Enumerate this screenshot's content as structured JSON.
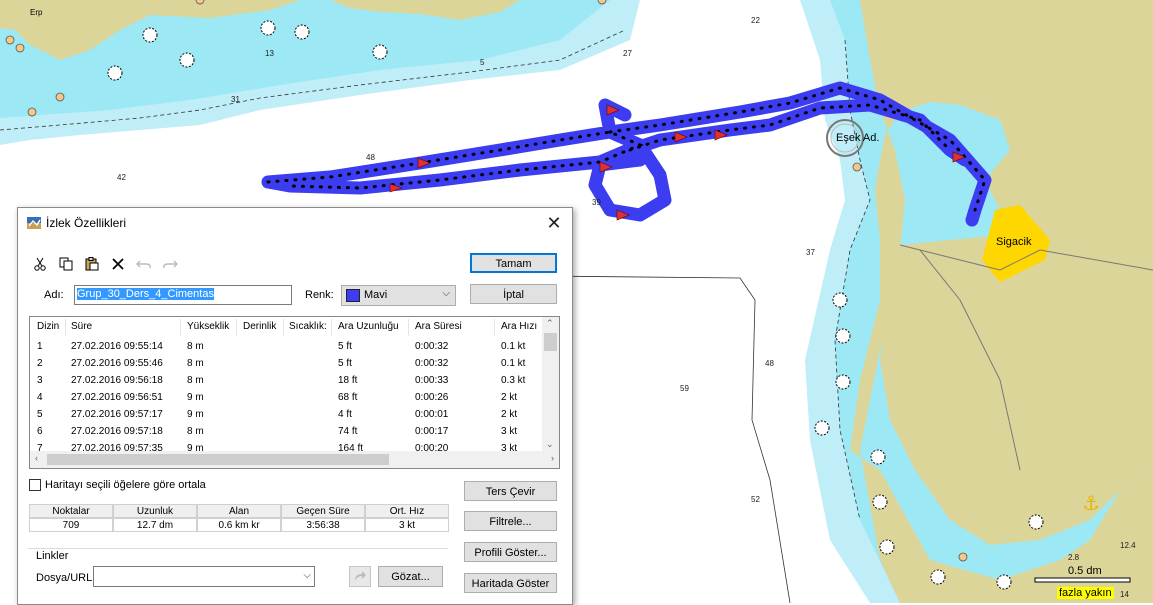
{
  "map": {
    "depths": [
      "22",
      "27",
      "13",
      "5",
      "31",
      "42",
      "48",
      "39",
      "37",
      "48",
      "59",
      "52",
      "2.8",
      "12.4",
      "14"
    ],
    "place_labels": {
      "erp": "Erp",
      "esek_ad": "Eşek Ad.",
      "sigacik": "Sigacik"
    },
    "scale": {
      "label": "0.5 dm",
      "zoom_warning": "fazla yakın"
    },
    "colors": {
      "land": "#dcd59a",
      "shallow": "#9de8f5",
      "medium": "#bfeef8",
      "deep": "#ffffff",
      "track": "#3c3cf0",
      "sigacik_area": "#ffd700"
    }
  },
  "dialog": {
    "title": "İzlek Özellikleri",
    "buttons": {
      "ok": "Tamam",
      "cancel": "İptal",
      "reverse": "Ters Çevir",
      "filter": "Filtrele...",
      "profile": "Profili Göster...",
      "show_on_map": "Haritada Göster",
      "go": "Gözat..."
    },
    "name_label": "Adı:",
    "name_value": "Grup_30_Ders_4_Cimentas",
    "color_label": "Renk:",
    "color_value": "Mavi",
    "table": {
      "columns": [
        "Dizin",
        "Süre",
        "Yükseklik",
        "Derinlik",
        "Sıcaklık:",
        "Ara Uzunluğu",
        "Ara Süresi",
        "Ara Hızı"
      ],
      "rows": [
        [
          "1",
          "27.02.2016 09:55:14",
          "8 m",
          "",
          "",
          "5 ft",
          "0:00:32",
          "0.1 kt"
        ],
        [
          "2",
          "27.02.2016 09:55:46",
          "8 m",
          "",
          "",
          "5 ft",
          "0:00:32",
          "0.1 kt"
        ],
        [
          "3",
          "27.02.2016 09:56:18",
          "8 m",
          "",
          "",
          "18 ft",
          "0:00:33",
          "0.3 kt"
        ],
        [
          "4",
          "27.02.2016 09:56:51",
          "9 m",
          "",
          "",
          "68 ft",
          "0:00:26",
          "2 kt"
        ],
        [
          "5",
          "27.02.2016 09:57:17",
          "9 m",
          "",
          "",
          "4 ft",
          "0:00:01",
          "2 kt"
        ],
        [
          "6",
          "27.02.2016 09:57:18",
          "8 m",
          "",
          "",
          "74 ft",
          "0:00:17",
          "3 kt"
        ],
        [
          "7",
          "27.02.2016 09:57:35",
          "9 m",
          "",
          "",
          "164 ft",
          "0:00:20",
          "3 kt"
        ]
      ]
    },
    "center_checkbox_label": "Haritayı seçili öğelere göre ortala",
    "stats": {
      "headers": [
        "Noktalar",
        "Uzunluk",
        "Alan",
        "Geçen Süre",
        "Ort. Hız"
      ],
      "values": [
        "709",
        "12.7 dm",
        "0.6 km kr",
        "3:56:38",
        "3 kt"
      ]
    },
    "links_group": "Linkler",
    "url_label": "Dosya/URL:",
    "url_value": ""
  }
}
